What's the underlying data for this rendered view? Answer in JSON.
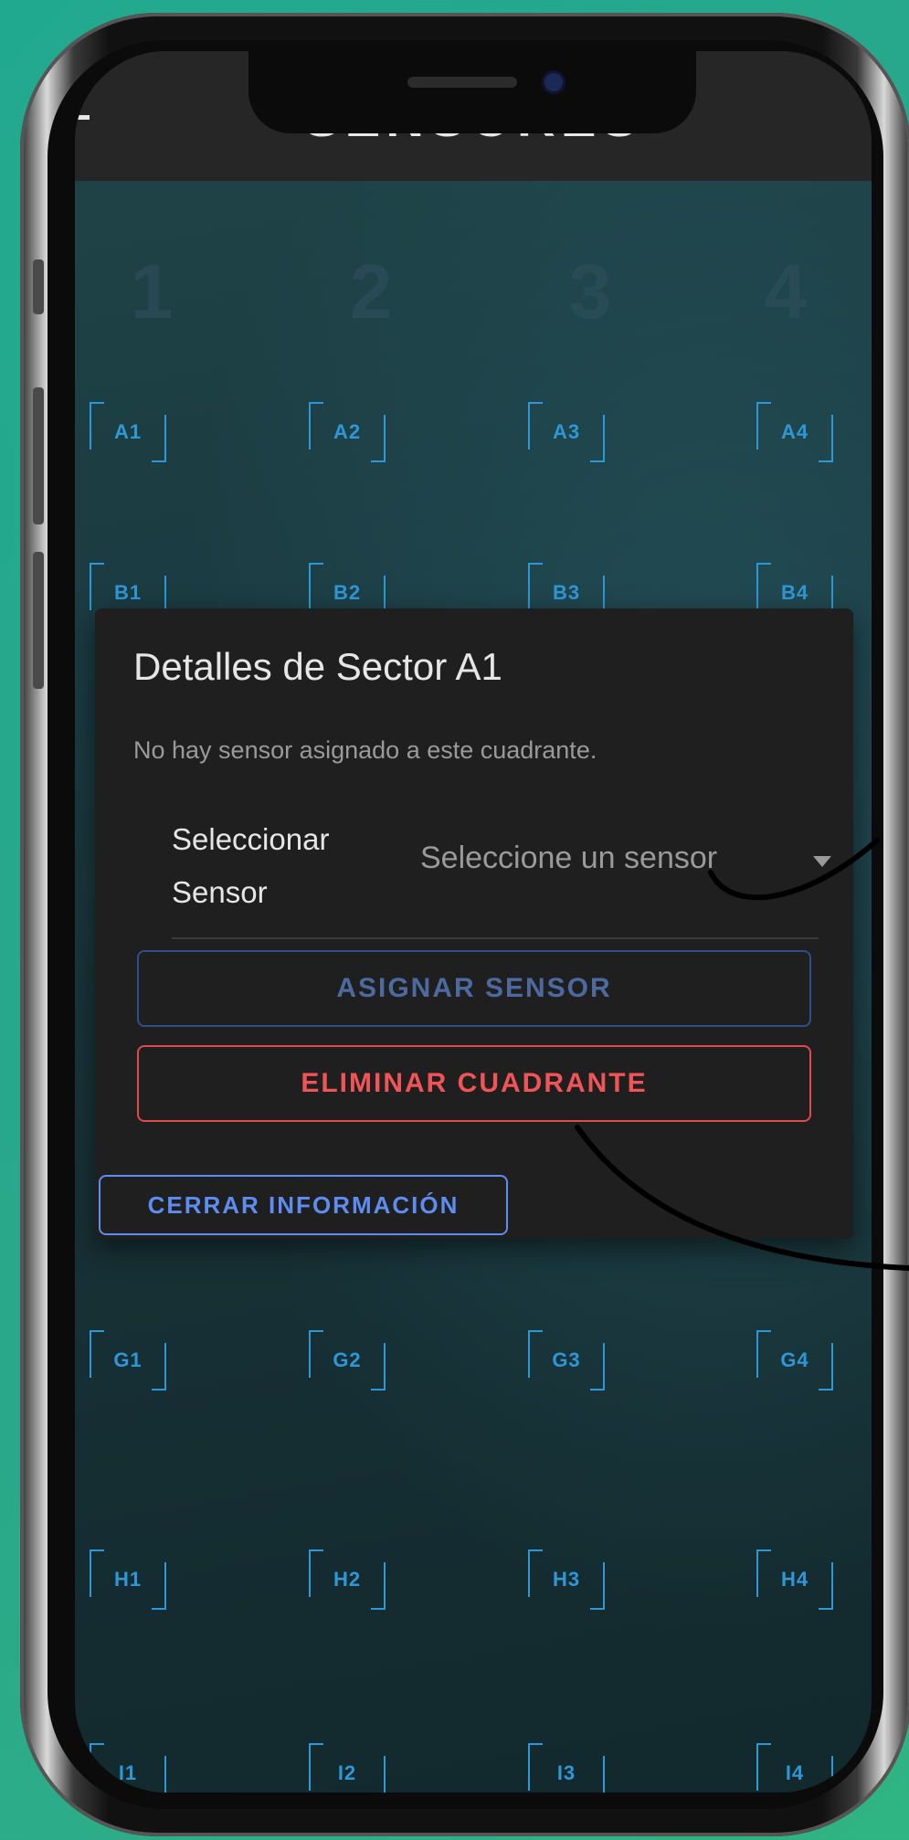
{
  "header": {
    "title": "SENSORES"
  },
  "grid": {
    "columns": [
      "1",
      "2",
      "3",
      "4"
    ],
    "rows": [
      {
        "cells": [
          "A1",
          "A2",
          "A3",
          "A4"
        ]
      },
      {
        "cells": [
          "B1",
          "B2",
          "B3",
          "B4"
        ]
      },
      {
        "cells": [
          "G1",
          "G2",
          "G3",
          "G4"
        ]
      },
      {
        "cells": [
          "H1",
          "H2",
          "H3",
          "H4"
        ]
      },
      {
        "cells": [
          "I1",
          "I2",
          "I3",
          "I4"
        ]
      }
    ]
  },
  "dialog": {
    "title": "Detalles de Sector A1",
    "message": "No hay sensor asignado a este cuadrante.",
    "select_label": "Seleccionar Sensor",
    "select_placeholder": "Seleccione un sensor",
    "assign_label": "ASIGNAR SENSOR",
    "delete_label": "ELIMINAR CUADRANTE",
    "close_label": "CERRAR INFORMACIÓN"
  },
  "colors": {
    "accent_blue": "#2f97d6",
    "danger_red": "#f05457",
    "close_blue": "#5f8cf0",
    "background_teal": "#21a98f"
  }
}
